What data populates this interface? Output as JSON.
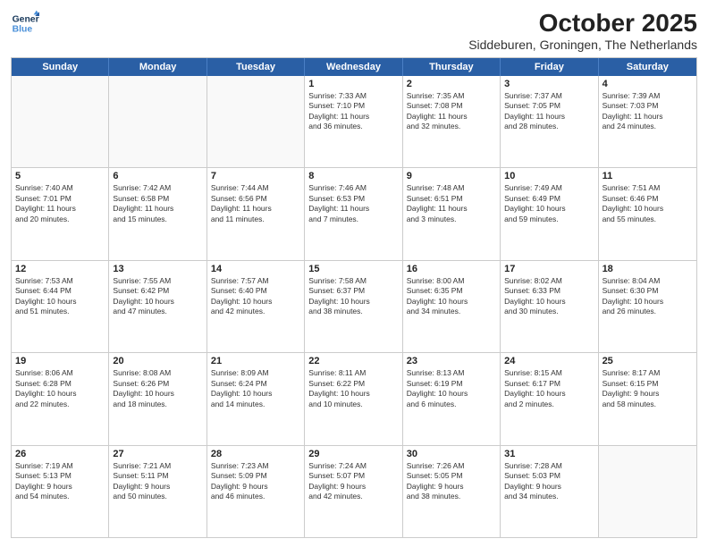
{
  "logo": {
    "line1": "General",
    "line2": "Blue"
  },
  "title": "October 2025",
  "subtitle": "Siddeburen, Groningen, The Netherlands",
  "days_of_week": [
    "Sunday",
    "Monday",
    "Tuesday",
    "Wednesday",
    "Thursday",
    "Friday",
    "Saturday"
  ],
  "weeks": [
    [
      {
        "day": "",
        "text": ""
      },
      {
        "day": "",
        "text": ""
      },
      {
        "day": "",
        "text": ""
      },
      {
        "day": "1",
        "text": "Sunrise: 7:33 AM\nSunset: 7:10 PM\nDaylight: 11 hours\nand 36 minutes."
      },
      {
        "day": "2",
        "text": "Sunrise: 7:35 AM\nSunset: 7:08 PM\nDaylight: 11 hours\nand 32 minutes."
      },
      {
        "day": "3",
        "text": "Sunrise: 7:37 AM\nSunset: 7:05 PM\nDaylight: 11 hours\nand 28 minutes."
      },
      {
        "day": "4",
        "text": "Sunrise: 7:39 AM\nSunset: 7:03 PM\nDaylight: 11 hours\nand 24 minutes."
      }
    ],
    [
      {
        "day": "5",
        "text": "Sunrise: 7:40 AM\nSunset: 7:01 PM\nDaylight: 11 hours\nand 20 minutes."
      },
      {
        "day": "6",
        "text": "Sunrise: 7:42 AM\nSunset: 6:58 PM\nDaylight: 11 hours\nand 15 minutes."
      },
      {
        "day": "7",
        "text": "Sunrise: 7:44 AM\nSunset: 6:56 PM\nDaylight: 11 hours\nand 11 minutes."
      },
      {
        "day": "8",
        "text": "Sunrise: 7:46 AM\nSunset: 6:53 PM\nDaylight: 11 hours\nand 7 minutes."
      },
      {
        "day": "9",
        "text": "Sunrise: 7:48 AM\nSunset: 6:51 PM\nDaylight: 11 hours\nand 3 minutes."
      },
      {
        "day": "10",
        "text": "Sunrise: 7:49 AM\nSunset: 6:49 PM\nDaylight: 10 hours\nand 59 minutes."
      },
      {
        "day": "11",
        "text": "Sunrise: 7:51 AM\nSunset: 6:46 PM\nDaylight: 10 hours\nand 55 minutes."
      }
    ],
    [
      {
        "day": "12",
        "text": "Sunrise: 7:53 AM\nSunset: 6:44 PM\nDaylight: 10 hours\nand 51 minutes."
      },
      {
        "day": "13",
        "text": "Sunrise: 7:55 AM\nSunset: 6:42 PM\nDaylight: 10 hours\nand 47 minutes."
      },
      {
        "day": "14",
        "text": "Sunrise: 7:57 AM\nSunset: 6:40 PM\nDaylight: 10 hours\nand 42 minutes."
      },
      {
        "day": "15",
        "text": "Sunrise: 7:58 AM\nSunset: 6:37 PM\nDaylight: 10 hours\nand 38 minutes."
      },
      {
        "day": "16",
        "text": "Sunrise: 8:00 AM\nSunset: 6:35 PM\nDaylight: 10 hours\nand 34 minutes."
      },
      {
        "day": "17",
        "text": "Sunrise: 8:02 AM\nSunset: 6:33 PM\nDaylight: 10 hours\nand 30 minutes."
      },
      {
        "day": "18",
        "text": "Sunrise: 8:04 AM\nSunset: 6:30 PM\nDaylight: 10 hours\nand 26 minutes."
      }
    ],
    [
      {
        "day": "19",
        "text": "Sunrise: 8:06 AM\nSunset: 6:28 PM\nDaylight: 10 hours\nand 22 minutes."
      },
      {
        "day": "20",
        "text": "Sunrise: 8:08 AM\nSunset: 6:26 PM\nDaylight: 10 hours\nand 18 minutes."
      },
      {
        "day": "21",
        "text": "Sunrise: 8:09 AM\nSunset: 6:24 PM\nDaylight: 10 hours\nand 14 minutes."
      },
      {
        "day": "22",
        "text": "Sunrise: 8:11 AM\nSunset: 6:22 PM\nDaylight: 10 hours\nand 10 minutes."
      },
      {
        "day": "23",
        "text": "Sunrise: 8:13 AM\nSunset: 6:19 PM\nDaylight: 10 hours\nand 6 minutes."
      },
      {
        "day": "24",
        "text": "Sunrise: 8:15 AM\nSunset: 6:17 PM\nDaylight: 10 hours\nand 2 minutes."
      },
      {
        "day": "25",
        "text": "Sunrise: 8:17 AM\nSunset: 6:15 PM\nDaylight: 9 hours\nand 58 minutes."
      }
    ],
    [
      {
        "day": "26",
        "text": "Sunrise: 7:19 AM\nSunset: 5:13 PM\nDaylight: 9 hours\nand 54 minutes."
      },
      {
        "day": "27",
        "text": "Sunrise: 7:21 AM\nSunset: 5:11 PM\nDaylight: 9 hours\nand 50 minutes."
      },
      {
        "day": "28",
        "text": "Sunrise: 7:23 AM\nSunset: 5:09 PM\nDaylight: 9 hours\nand 46 minutes."
      },
      {
        "day": "29",
        "text": "Sunrise: 7:24 AM\nSunset: 5:07 PM\nDaylight: 9 hours\nand 42 minutes."
      },
      {
        "day": "30",
        "text": "Sunrise: 7:26 AM\nSunset: 5:05 PM\nDaylight: 9 hours\nand 38 minutes."
      },
      {
        "day": "31",
        "text": "Sunrise: 7:28 AM\nSunset: 5:03 PM\nDaylight: 9 hours\nand 34 minutes."
      },
      {
        "day": "",
        "text": ""
      }
    ]
  ]
}
